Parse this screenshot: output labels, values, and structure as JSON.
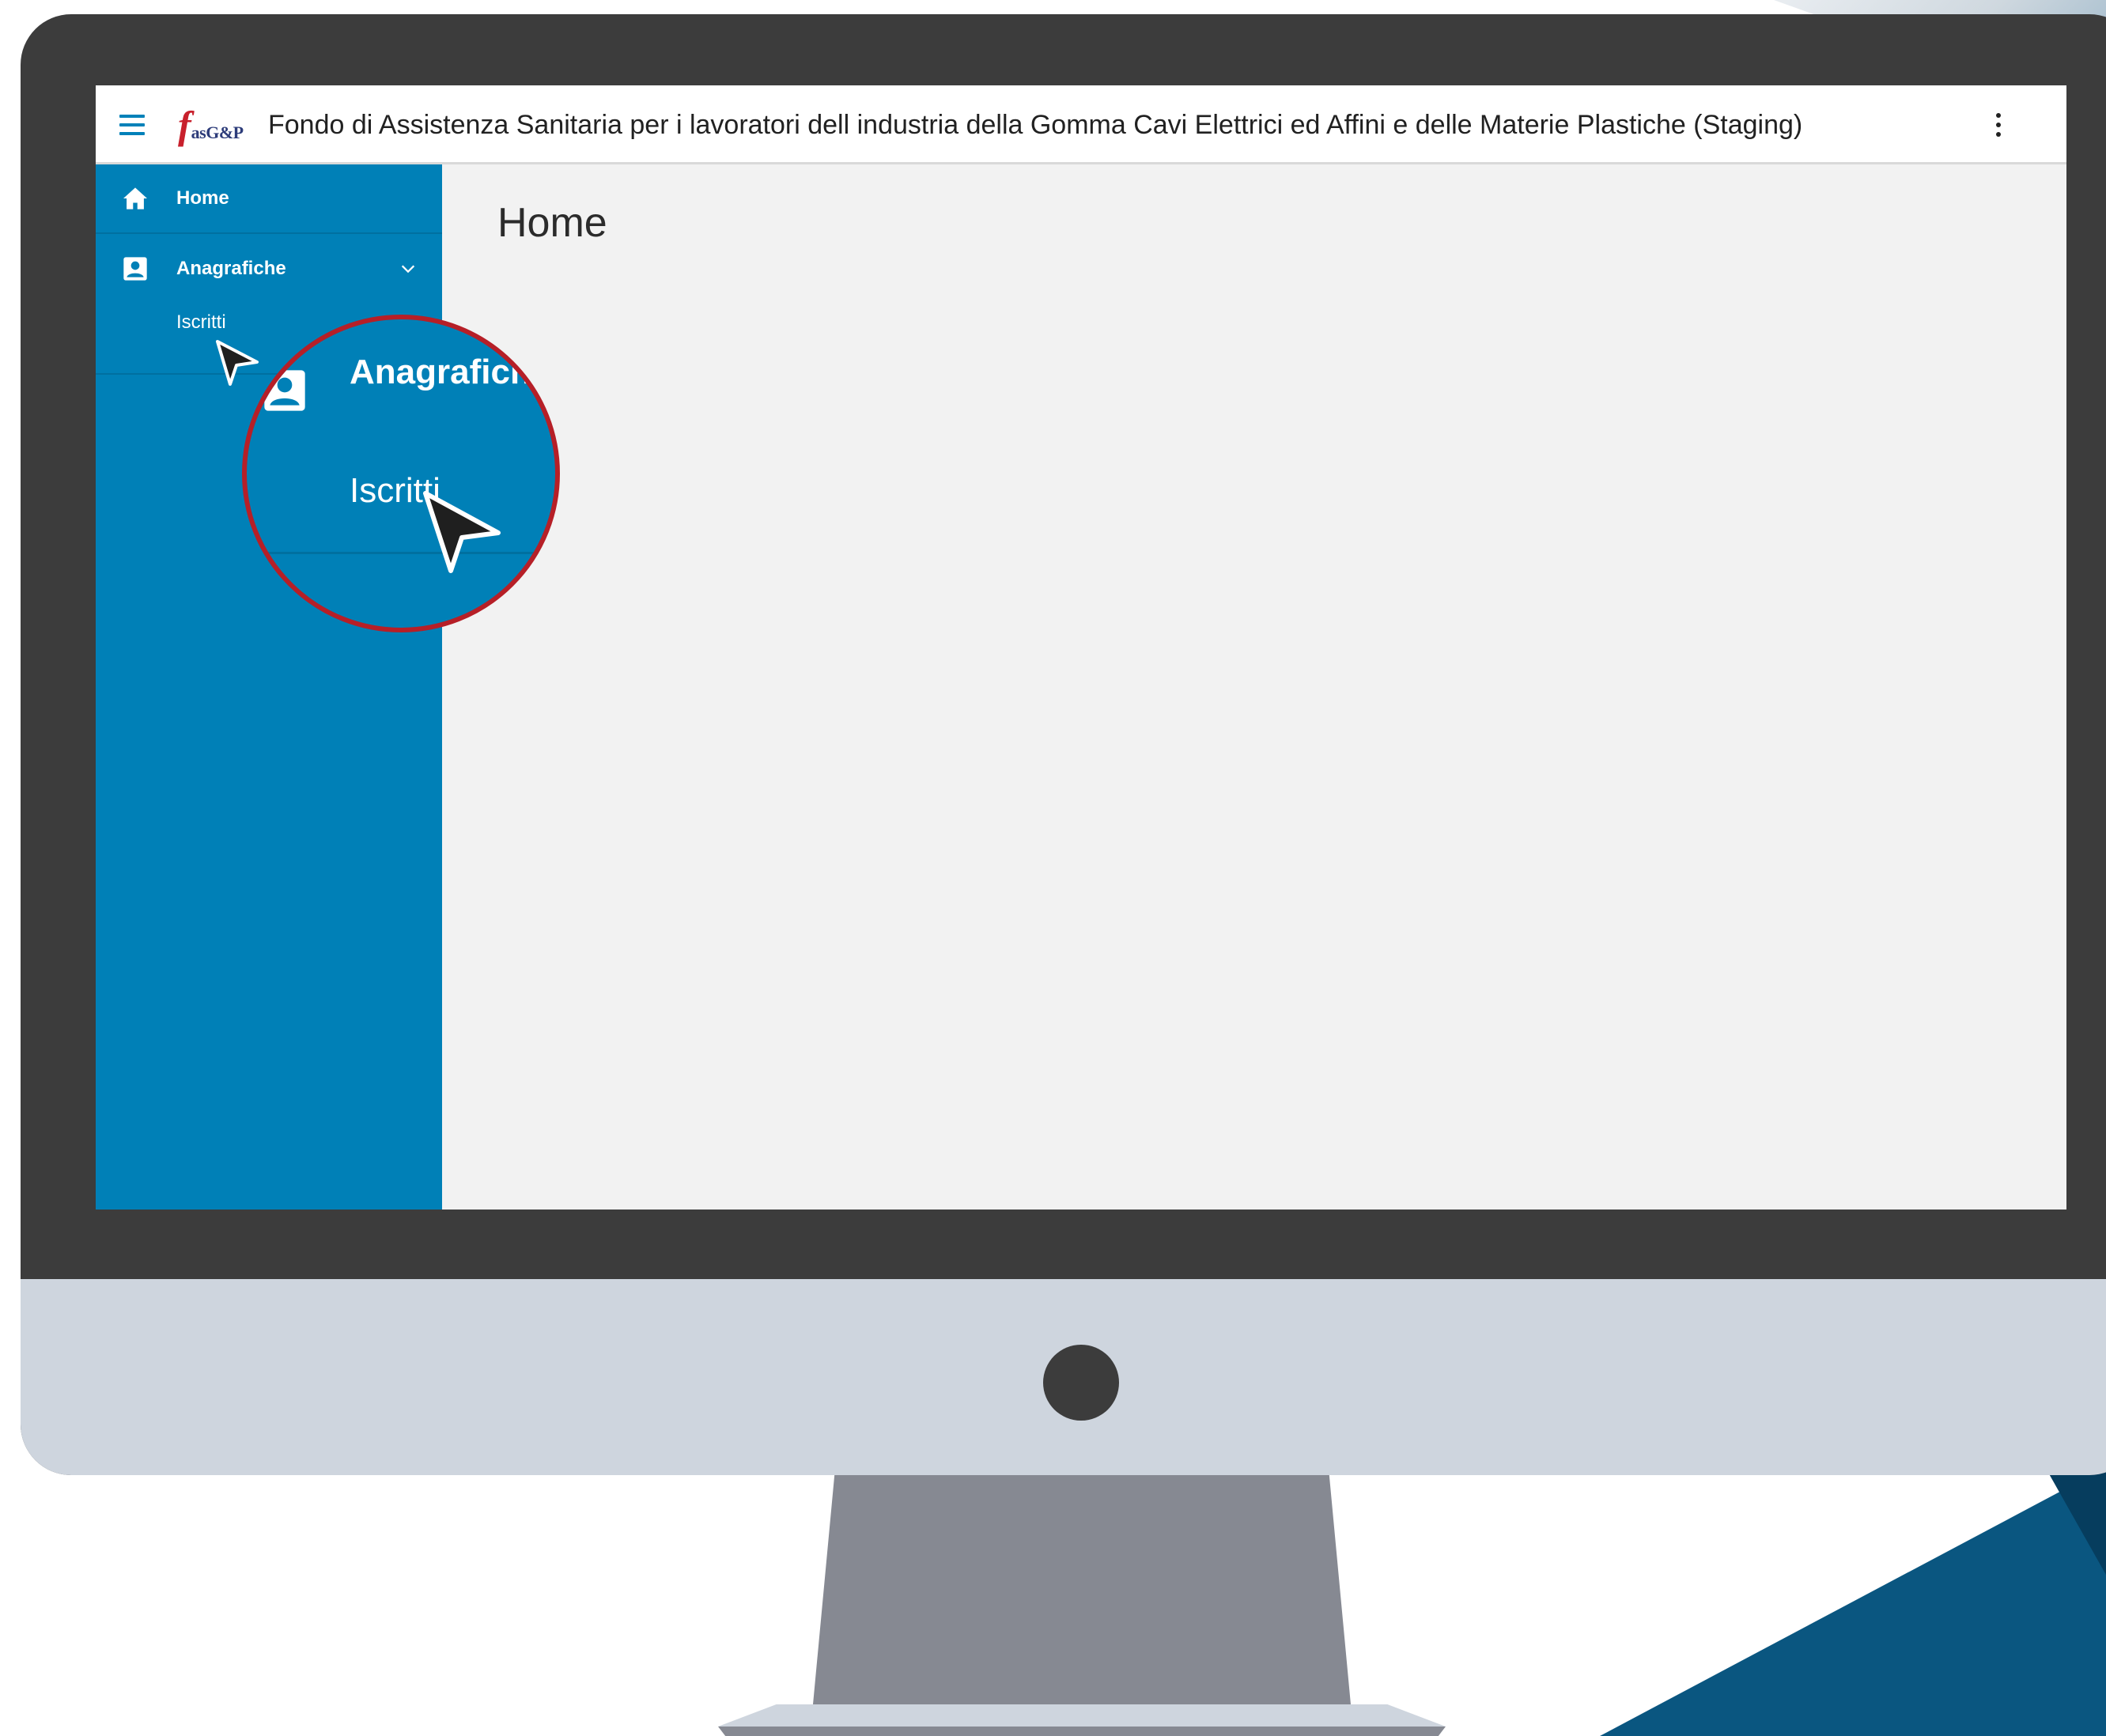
{
  "app": {
    "logo_letter": "f",
    "logo_rest": "asG&P",
    "title": "Fondo di Assistenza Sanitaria per i lavoratori dell industria della Gomma Cavi Elettrici ed Affini e delle Materie Plastiche (Staging)"
  },
  "sidebar": {
    "items": [
      {
        "label": "Home",
        "icon": "home-icon"
      },
      {
        "label": "Anagrafiche",
        "icon": "contact-card-icon",
        "expanded": true,
        "children": [
          {
            "label": "Iscritti"
          }
        ]
      }
    ]
  },
  "main": {
    "page_title": "Home"
  },
  "callout": {
    "heading": "Anagrafiche",
    "sub": "Iscritti"
  },
  "colors": {
    "sidebar": "#0080b7",
    "accent": "#0081b9",
    "callout_border": "#b61f27",
    "content_bg": "#f2f2f2"
  }
}
